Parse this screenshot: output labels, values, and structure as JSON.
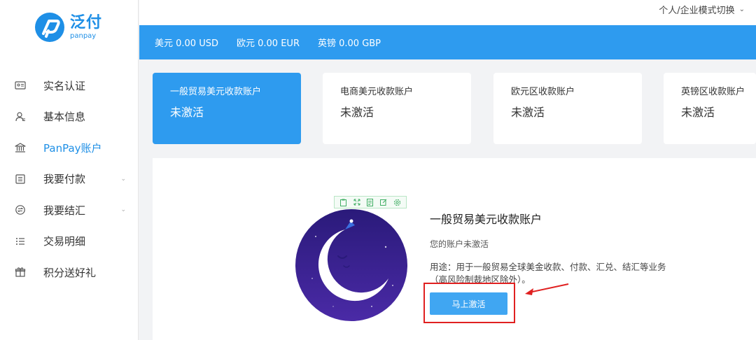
{
  "brand": {
    "name_cn": "泛付",
    "name_en": "panpay"
  },
  "header": {
    "mode_switch_label": "个人/企业模式切换"
  },
  "sidebar": {
    "items": [
      {
        "label": "实名认证",
        "icon": "id-card-icon"
      },
      {
        "label": "基本信息",
        "icon": "user-icon"
      },
      {
        "label": "PanPay账户",
        "icon": "bank-icon",
        "active": true
      },
      {
        "label": "我要付款",
        "icon": "payment-icon",
        "expandable": true
      },
      {
        "label": "我要结汇",
        "icon": "exchange-icon",
        "expandable": true
      },
      {
        "label": "交易明细",
        "icon": "list-icon"
      },
      {
        "label": "积分送好礼",
        "icon": "gift-icon"
      }
    ]
  },
  "balances": [
    {
      "text": "美元 0.00 USD"
    },
    {
      "text": "欧元 0.00 EUR"
    },
    {
      "text": "英镑 0.00 GBP"
    }
  ],
  "accounts": [
    {
      "title": "一般贸易美元收款账户",
      "status": "未激活",
      "active": true
    },
    {
      "title": "电商美元收款账户",
      "status": "未激活"
    },
    {
      "title": "欧元区收款账户",
      "status": "未激活"
    },
    {
      "title": "英镑区收款账户",
      "status": "未激活"
    }
  ],
  "detail": {
    "title": "一般贸易美元收款账户",
    "status": "您的账户未激活",
    "usage": "用途：用于一般贸易全球美金收款、付款、汇兑、结汇等业务（高风险制裁地区除外）。",
    "activate_label": "马上激活"
  },
  "colors": {
    "primary": "#2e9bef",
    "button": "#40a6f2",
    "highlight_frame": "#e02020",
    "moon_bg": "#3a1f8a"
  }
}
